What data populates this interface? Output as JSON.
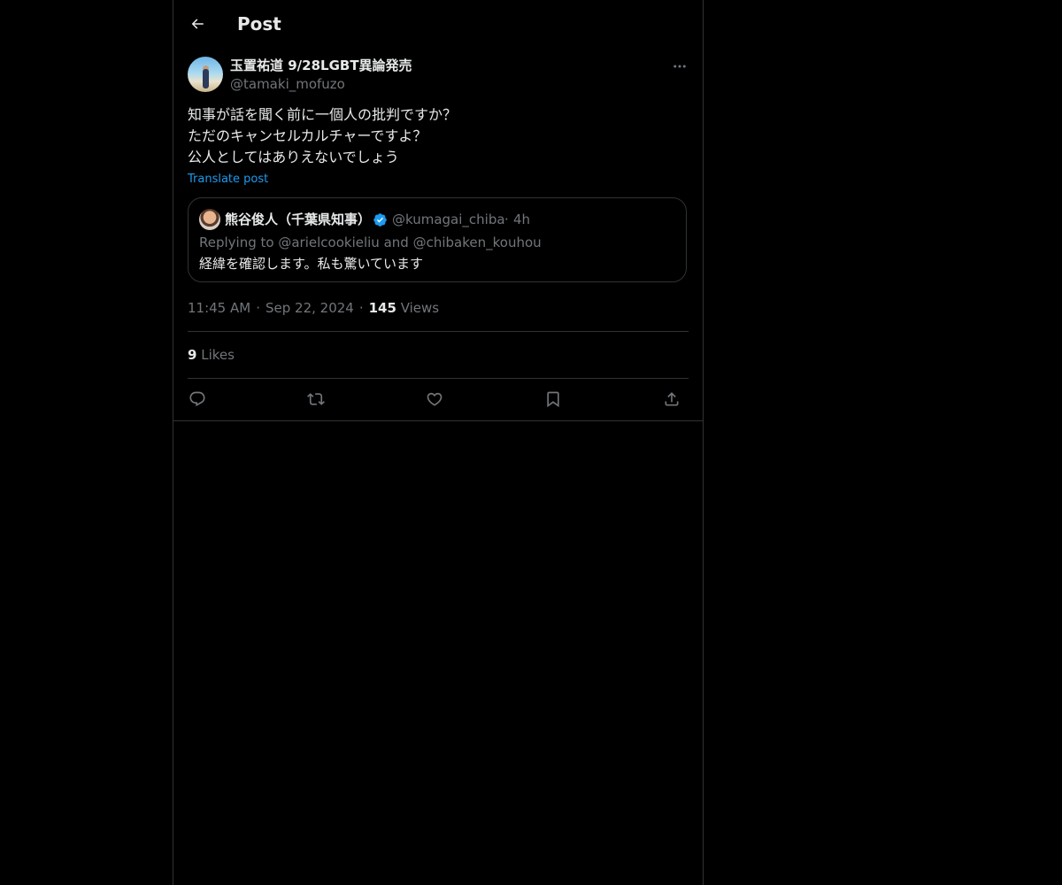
{
  "header": {
    "title": "Post",
    "back_icon": "arrow-left-icon"
  },
  "post": {
    "author": {
      "display_name": "玉置祐道 9/28LGBT異論発売",
      "handle": "@tamaki_mofuzo"
    },
    "more_icon": "more-horizontal-icon",
    "text_lines": [
      "知事が話を聞く前に一個人の批判ですか？",
      "ただのキャンセルカルチャーですよ？",
      "公人としてはありえないでしょう"
    ],
    "translate_label": "Translate post",
    "quote": {
      "display_name": "熊谷俊人（千葉県知事）",
      "verified_icon": "verified-badge-icon",
      "handle": "@kumagai_chiba",
      "separator": "·",
      "time": "4h",
      "replying_prefix": "Replying to",
      "replying_to_1": "@arielcookieliu",
      "replying_and": "and",
      "replying_to_2": "@chibaken_kouhou",
      "text": "経緯を確認します。私も驚いています"
    },
    "meta": {
      "time": "11:45 AM",
      "date": "Sep 22, 2024",
      "separator": "·",
      "views_count": "145",
      "views_label": "Views"
    },
    "likes": {
      "count": "9",
      "label": "Likes"
    },
    "actions": [
      {
        "name": "reply",
        "icon": "reply-icon"
      },
      {
        "name": "repost",
        "icon": "repost-icon"
      },
      {
        "name": "like",
        "icon": "heart-icon"
      },
      {
        "name": "bookmark",
        "icon": "bookmark-icon"
      },
      {
        "name": "share",
        "icon": "share-icon"
      }
    ]
  },
  "colors": {
    "background": "#000000",
    "text_primary": "#e7e9ea",
    "text_secondary": "#71767b",
    "border": "#2f3336",
    "accent": "#1d9bf0"
  }
}
